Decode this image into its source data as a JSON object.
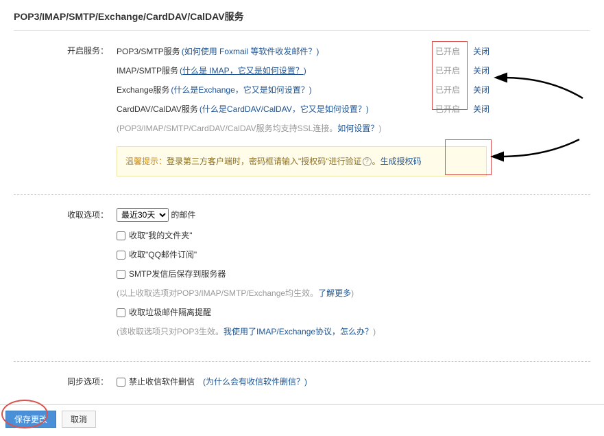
{
  "page_title": "POP3/IMAP/SMTP/Exchange/CardDAV/CalDAV服务",
  "services_label": "开启服务：",
  "services": [
    {
      "name": "POP3/SMTP服务",
      "help_prefix": "(",
      "help_text": "如何使用 Foxmail 等软件收发邮件？",
      "help_suffix": ")",
      "status": "已开启",
      "close": "关闭",
      "underline": false
    },
    {
      "name": "IMAP/SMTP服务",
      "help_prefix": "(",
      "help_text": "什么是 IMAP，它又是如何设置？",
      "help_suffix": ")",
      "status": "已开启",
      "close": "关闭",
      "underline": true
    },
    {
      "name": "Exchange服务",
      "help_prefix": "(",
      "help_text": "什么是Exchange，它又是如何设置？",
      "help_suffix": ")",
      "status": "已开启",
      "close": "关闭",
      "underline": false
    },
    {
      "name": "CardDAV/CalDAV服务",
      "help_prefix": "(",
      "help_text": "什么是CardDAV/CalDAV，它又是如何设置？",
      "help_suffix": ")",
      "status": "已开启",
      "close": "关闭",
      "underline": false
    }
  ],
  "ssl_note_prefix": "(POP3/IMAP/SMTP/CardDAV/CalDAV服务均支持SSL连接。",
  "ssl_note_link": "如何设置？",
  "ssl_note_suffix": ")",
  "hint_label": "温馨提示：",
  "hint_text": "登录第三方客户端时，密码框请输入\"授权码\"进行验证",
  "hint_period": "。",
  "gen_code": "生成授权码",
  "receive_label": "收取选项：",
  "select_value": "最近30天",
  "select_suffix": "的邮件",
  "recv_checks": [
    {
      "label": "收取\"我的文件夹\""
    },
    {
      "label": "收取\"QQ邮件订阅\""
    },
    {
      "label": "SMTP发信后保存到服务器"
    }
  ],
  "recv_note_prefix": "(以上收取选项对POP3/IMAP/SMTP/Exchange均生效。",
  "recv_note_link": "了解更多",
  "recv_note_suffix": ")",
  "junk_check": "收取垃圾邮件隔离提醒",
  "junk_note_prefix": "(该收取选项只对POP3生效。",
  "junk_note_link": "我使用了IMAP/Exchange协议，怎么办？",
  "junk_note_suffix": ")",
  "sync_label": "同步选项：",
  "sync_check": "禁止收信软件删信",
  "sync_help_prefix": "(",
  "sync_help_text": "为什么会有收信软件删信？",
  "sync_help_suffix": ")",
  "btn_save": "保存更改",
  "btn_cancel": "取消"
}
